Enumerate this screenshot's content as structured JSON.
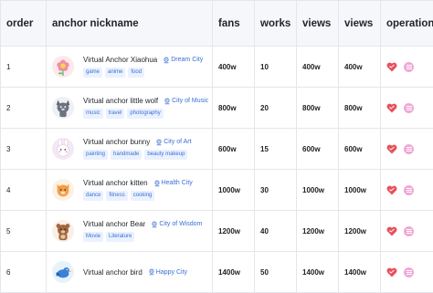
{
  "columns": [
    "order",
    "anchor nickname",
    "fans",
    "works",
    "views",
    "views",
    "operation"
  ],
  "rows": [
    {
      "order": "1",
      "name": "Virtual Anchor Xiaohua",
      "city": "Dream City",
      "tags": [
        "game",
        "anime",
        "food"
      ],
      "fans": "400w",
      "works": "10",
      "views1": "400w",
      "views2": "400w",
      "avatar": "flower-avatar",
      "avatar_bg": "#fde8ec"
    },
    {
      "order": "2",
      "name": "Virtual anchor little wolf",
      "city": "City of Music",
      "tags": [
        "music",
        "travel",
        "photography"
      ],
      "fans": "800w",
      "works": "20",
      "views1": "800w",
      "views2": "800w",
      "avatar": "wolf-avatar",
      "avatar_bg": "#eef0f3"
    },
    {
      "order": "3",
      "name": "Virtual anchor bunny",
      "city": "City of Art",
      "tags": [
        "painting",
        "handmade",
        "beauty makeup"
      ],
      "fans": "600w",
      "works": "15",
      "views1": "600w",
      "views2": "600w",
      "avatar": "bunny-avatar",
      "avatar_bg": "#f3e9f6"
    },
    {
      "order": "4",
      "name": "Virtual anchor kitten",
      "city": "Health City",
      "tags": [
        "dance",
        "fitness",
        "cooking"
      ],
      "fans": "1000w",
      "works": "30",
      "views1": "1000w",
      "views2": "1000w",
      "avatar": "kitten-avatar",
      "avatar_bg": "#fdf1e3"
    },
    {
      "order": "5",
      "name": "Virtual anchor Bear",
      "city": "City of Wisdom",
      "tags": [
        "Movie",
        "Literature"
      ],
      "fans": "1200w",
      "works": "40",
      "views1": "1200w",
      "views2": "1200w",
      "avatar": "bear-avatar",
      "avatar_bg": "#fbeee6"
    },
    {
      "order": "6",
      "name": "Virtual anchor bird",
      "city": "Happy City",
      "tags": [],
      "fans": "1400w",
      "works": "50",
      "views1": "1400w",
      "views2": "1400w",
      "avatar": "bird-avatar",
      "avatar_bg": "#e8f2fc"
    }
  ],
  "colors": {
    "accent": "#3b6fd4",
    "heart": "#e8505b",
    "message": "#f2a7d6"
  }
}
